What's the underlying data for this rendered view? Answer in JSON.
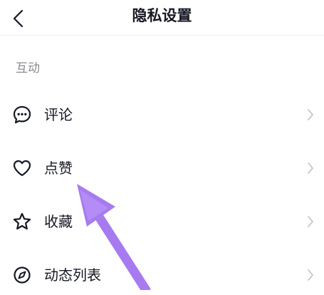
{
  "header": {
    "title": "隐私设置"
  },
  "section": {
    "label": "互动"
  },
  "items": [
    {
      "label": "评论",
      "icon": "comment-icon"
    },
    {
      "label": "点赞",
      "icon": "heart-icon"
    },
    {
      "label": "收藏",
      "icon": "star-icon"
    },
    {
      "label": "动态列表",
      "icon": "compass-icon"
    }
  ],
  "colors": {
    "text": "#161823",
    "secondary": "#8a8b91",
    "chevron": "#c7c8cc",
    "annotation_arrow": "#a77bf0"
  }
}
